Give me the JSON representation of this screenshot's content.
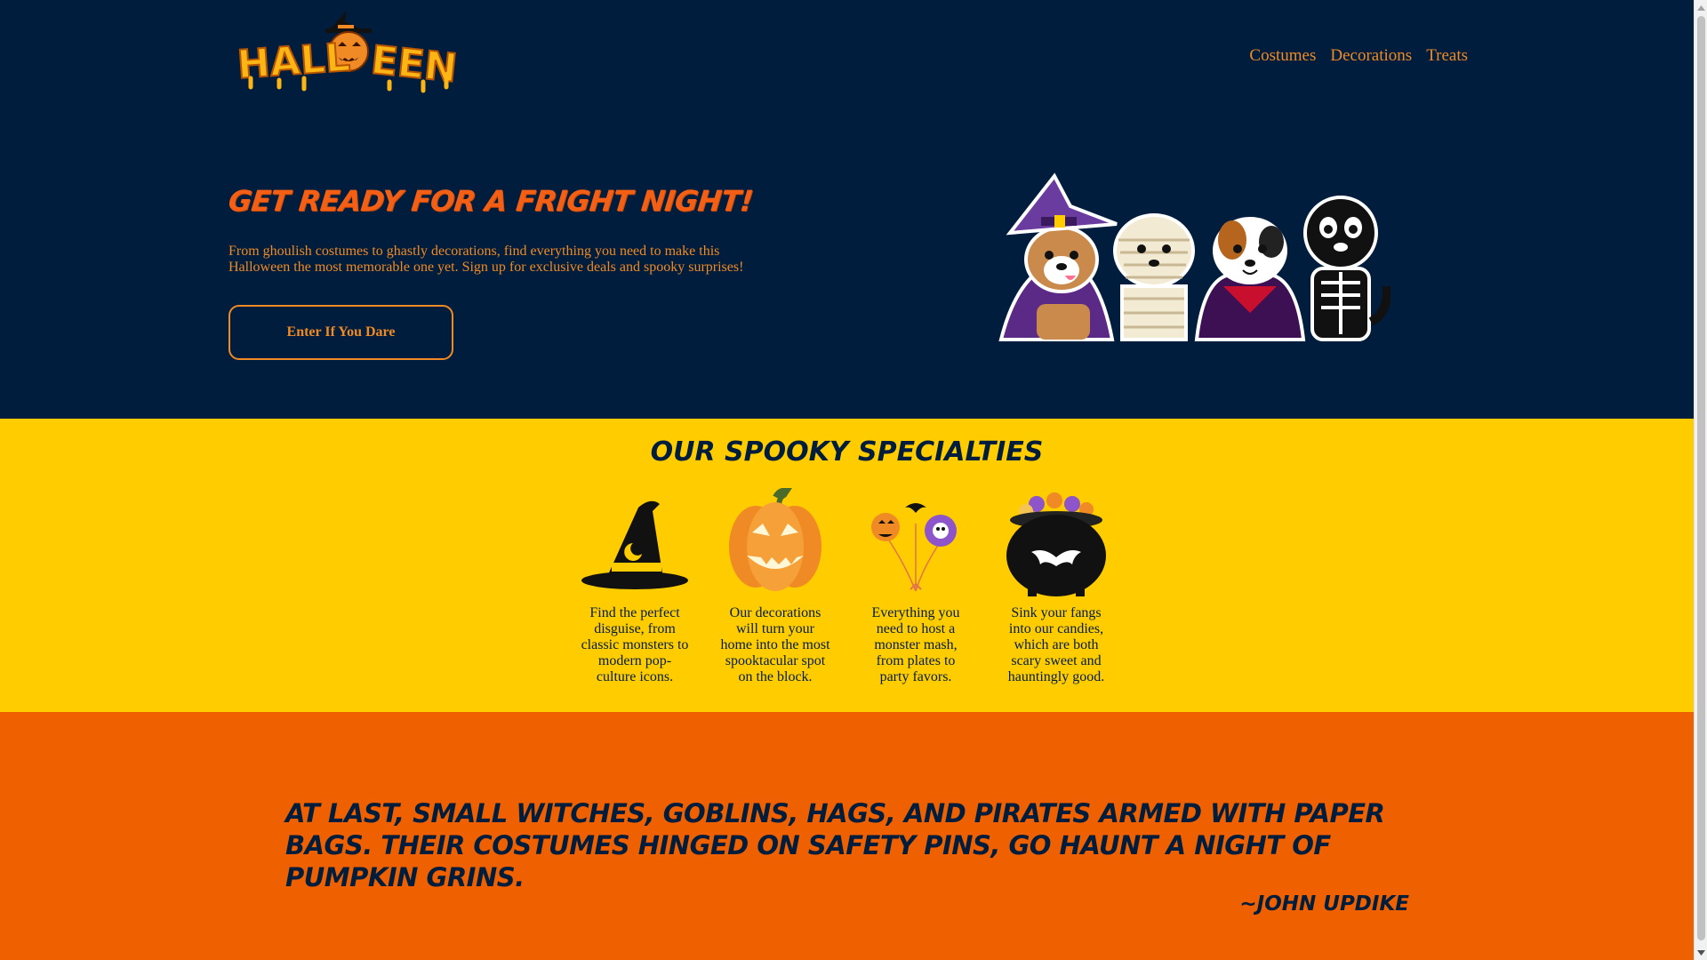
{
  "header": {
    "logo_text": "HALLOWEEN",
    "nav": [
      {
        "label": "Costumes"
      },
      {
        "label": "Decorations"
      },
      {
        "label": "Treats"
      }
    ]
  },
  "hero": {
    "title": "GET READY FOR A FRIGHT NIGHT!",
    "text": "From ghoulish costumes to ghastly decorations, find everything you need to make this Halloween the most memorable one yet. Sign up for exclusive deals and spooky surprises!",
    "cta_label": "Enter If You Dare",
    "image_icon": "halloween-dogs-illustration"
  },
  "specialties": {
    "title": "OUR SPOOKY SPECIALTIES",
    "items": [
      {
        "icon": "witch-hat-icon",
        "text": "Find the perfect disguise, from classic monsters to modern pop-culture icons."
      },
      {
        "icon": "jack-o-lantern-icon",
        "text": "Our decorations will turn your home into the most spooktacular spot on the block."
      },
      {
        "icon": "balloons-icon",
        "text": "Everything you need to host a monster mash, from plates to party favors."
      },
      {
        "icon": "cauldron-icon",
        "text": "Sink your fangs into our candies, which are both scary sweet and hauntingly good."
      }
    ]
  },
  "quote": {
    "text": "AT LAST, SMALL WITCHES, GOBLINS, HAGS, AND PIRATES ARMED WITH PAPER BAGS. THEIR COSTUMES HINGED ON SAFETY PINS, GO HAUNT A NIGHT OF PUMPKIN GRINS.",
    "author": "~JOHN UPDIKE"
  },
  "colors": {
    "navy": "#001d3d",
    "orange": "#f08a24",
    "yellow": "#ffcc00",
    "deep_orange": "#ee6000"
  }
}
